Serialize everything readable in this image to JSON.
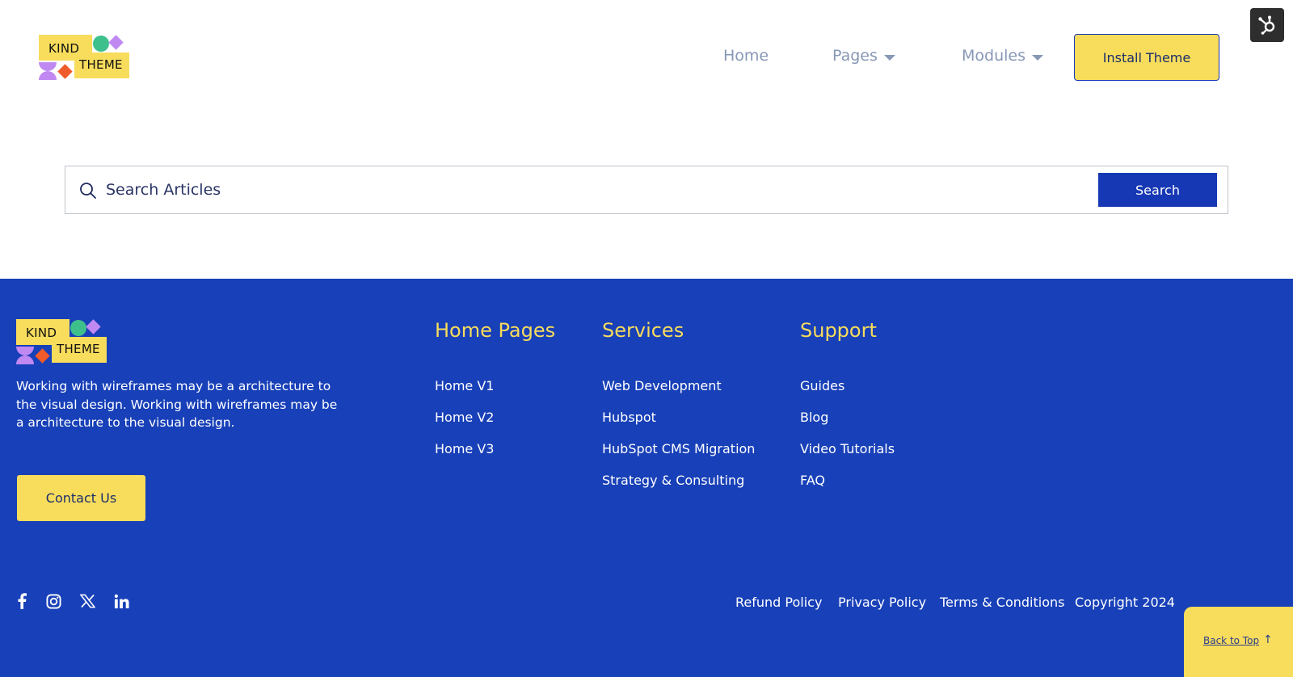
{
  "brand": {
    "line1": "KIND",
    "line2": "THEME",
    "colors": {
      "yellow": "#f8dc5c",
      "blue": "#1840b8",
      "green": "#3ec08d",
      "purple": "#c089f2",
      "orange": "#ef5b2a"
    }
  },
  "nav": {
    "home": "Home",
    "pages": "Pages",
    "modules": "Modules",
    "install": "Install Theme",
    "hubspot_icon": "hubspot-sprocket-icon"
  },
  "search": {
    "placeholder": "Search Articles",
    "button": "Search"
  },
  "footer": {
    "description": "Working with wireframes may be a architecture to the visual design. Working with wireframes may be a architecture to the visual design.",
    "contact": "Contact Us",
    "columns": [
      {
        "heading": "Home Pages",
        "links": [
          "Home V1",
          "Home V2",
          "Home V3"
        ]
      },
      {
        "heading": "Services",
        "links": [
          "Web Development",
          "Hubspot",
          "HubSpot CMS Migration",
          "Strategy & Consulting"
        ]
      },
      {
        "heading": "Support",
        "links": [
          "Guides",
          "Blog",
          "Video Tutorials",
          "FAQ"
        ]
      }
    ],
    "social": [
      "facebook-icon",
      "instagram-icon",
      "x-icon",
      "linkedin-icon"
    ],
    "legal": [
      "Refund Policy",
      "Privacy Policy",
      "Terms & Conditions",
      "Copyright 2024"
    ],
    "back_to_top": "Back to Top"
  }
}
